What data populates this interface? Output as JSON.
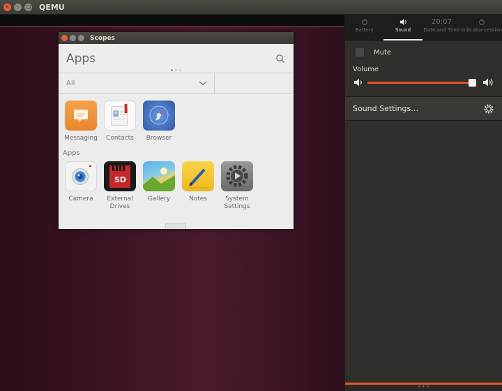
{
  "window": {
    "title": "QEMU"
  },
  "scopes": {
    "title": "Scopes",
    "header_title": "Apps",
    "filter_value": "All",
    "featured": [
      {
        "label": "Messaging",
        "icon": "messaging-icon",
        "color": "#f0903a"
      },
      {
        "label": "Contacts",
        "icon": "contacts-icon",
        "color": "#ffffff"
      },
      {
        "label": "Browser",
        "icon": "browser-icon",
        "color": "#3a6ec0"
      }
    ],
    "apps_section_title": "Apps",
    "apps": [
      {
        "label": "Camera",
        "icon": "camera-icon"
      },
      {
        "label": "External Drives",
        "icon": "sd-card-icon",
        "sd_text": "SD"
      },
      {
        "label": "Gallery",
        "icon": "gallery-icon"
      },
      {
        "label": "Notes",
        "icon": "notes-icon"
      },
      {
        "label": "System Settings",
        "icon": "settings-icon"
      }
    ]
  },
  "indicators": {
    "tabs": [
      {
        "label": "Battery",
        "icon": "battery-icon"
      },
      {
        "label": "Sound",
        "icon": "speaker-icon",
        "active": true
      },
      {
        "label": "Date and Time",
        "time": "20:07"
      },
      {
        "label": "Indicator-session",
        "icon": "session-icon"
      }
    ],
    "mute_label": "Mute",
    "mute_checked": false,
    "volume_label": "Volume",
    "volume_level": 0.97,
    "sound_settings_label": "Sound Settings…",
    "accent_color": "#e2572b"
  }
}
